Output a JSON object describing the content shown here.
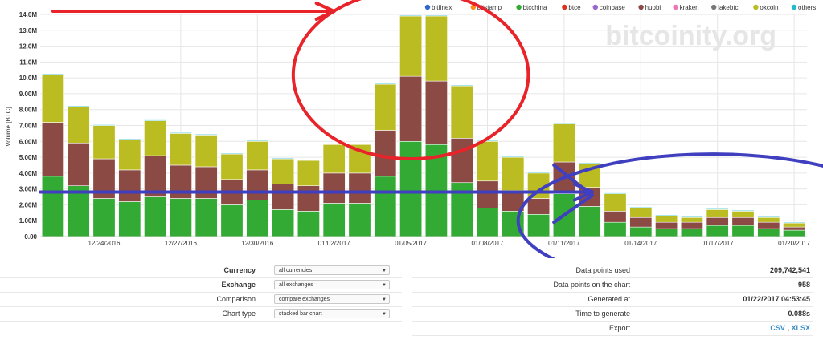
{
  "watermark": "bitcoinity.org",
  "chart_data": {
    "type": "bar",
    "stacked": true,
    "ylabel": "Volume [BTC]",
    "ylim": [
      0,
      14000000
    ],
    "yticks": [
      "0.00",
      "1.00M",
      "2.00M",
      "3.00M",
      "4.00M",
      "5.00M",
      "6.00M",
      "7.00M",
      "8.00M",
      "9.00M",
      "10.0M",
      "11.0M",
      "12.0M",
      "13.0M",
      "14.0M"
    ],
    "xtick_labels": [
      {
        "label": "12/24/2016",
        "index": 2.5
      },
      {
        "label": "12/27/2016",
        "index": 5.5
      },
      {
        "label": "12/30/2016",
        "index": 8.5
      },
      {
        "label": "01/02/2017",
        "index": 11.5
      },
      {
        "label": "01/05/2017",
        "index": 14.5
      },
      {
        "label": "01/08/2017",
        "index": 17.5
      },
      {
        "label": "01/11/2017",
        "index": 20.5
      },
      {
        "label": "01/14/2017",
        "index": 23.5
      },
      {
        "label": "01/17/2017",
        "index": 26.5
      },
      {
        "label": "01/20/2017",
        "index": 29.5
      }
    ],
    "legend": [
      "bitfinex",
      "bitstamp",
      "btcchina",
      "btce",
      "coinbase",
      "huobi",
      "kraken",
      "lakebtc",
      "okcoin",
      "others"
    ],
    "colors": {
      "bitfinex": "#3366cc",
      "bitstamp": "#ff8c1a",
      "btcchina": "#33aa33",
      "btce": "#dd3322",
      "coinbase": "#9966cc",
      "huobi": "#8b4a44",
      "kraken": "#ee77bb",
      "lakebtc": "#777777",
      "okcoin": "#bbbb22",
      "others": "#22bbcc"
    },
    "series": [
      {
        "name": "btcchina",
        "values": [
          3800000,
          3200000,
          2400000,
          2200000,
          2500000,
          2400000,
          2400000,
          2000000,
          2300000,
          1700000,
          1600000,
          2100000,
          2100000,
          3800000,
          6000000,
          5800000,
          3400000,
          1800000,
          1600000,
          1400000,
          2700000,
          1900000,
          900000,
          600000,
          500000,
          500000,
          700000,
          700000,
          500000,
          400000
        ]
      },
      {
        "name": "huobi",
        "values": [
          3400000,
          2700000,
          2500000,
          2000000,
          2600000,
          2100000,
          2000000,
          1600000,
          1900000,
          1600000,
          1600000,
          1900000,
          1900000,
          2900000,
          4100000,
          4000000,
          2800000,
          1700000,
          1300000,
          1000000,
          2000000,
          1200000,
          700000,
          600000,
          400000,
          400000,
          500000,
          500000,
          400000,
          200000
        ]
      },
      {
        "name": "okcoin",
        "values": [
          3000000,
          2300000,
          2100000,
          1900000,
          2200000,
          2000000,
          2000000,
          1600000,
          1800000,
          1600000,
          1600000,
          1800000,
          1800000,
          2900000,
          3800000,
          4100000,
          3300000,
          2500000,
          2100000,
          1600000,
          2400000,
          1500000,
          1100000,
          600000,
          400000,
          300000,
          500000,
          400000,
          300000,
          250000
        ]
      },
      {
        "name": "others",
        "values": [
          50000,
          50000,
          50000,
          50000,
          50000,
          50000,
          50000,
          50000,
          50000,
          50000,
          50000,
          50000,
          50000,
          50000,
          50000,
          50000,
          50000,
          50000,
          50000,
          50000,
          50000,
          50000,
          50000,
          50000,
          50000,
          50000,
          50000,
          50000,
          50000,
          50000
        ]
      }
    ],
    "grid": true,
    "legend_position": "top-right"
  },
  "annotations": [
    {
      "type": "arrow",
      "color": "#e8232a",
      "from_index": 0.5,
      "from_value": 14000000,
      "to_index": 11.5,
      "to_value": 14000000
    },
    {
      "type": "ellipse",
      "color": "#e8232a",
      "center_index": 14.5,
      "center_value": 10200000,
      "rx_bars": 4.6,
      "ry_value": 5300000
    },
    {
      "type": "arrow",
      "color": "#3f3fc0",
      "from_index": 0,
      "from_value": 2600000,
      "to_index": 21.6,
      "to_value": 2600000
    },
    {
      "type": "line",
      "color": "#3f3fc0",
      "from_index": 20.1,
      "from_value": 900000,
      "to_index": 21.6,
      "to_value": 2600000
    },
    {
      "type": "line",
      "color": "#3f3fc0",
      "from_index": 20.1,
      "from_value": 4500000,
      "to_index": 21.6,
      "to_value": 2600000
    },
    {
      "type": "ellipse",
      "color": "#3f3fc0",
      "center_index": 26.3,
      "center_value": 1000000,
      "rx_bars": 7.6,
      "ry_value": 4200000
    }
  ],
  "settings": [
    {
      "label": "Currency",
      "bold": true,
      "value": "all currencies"
    },
    {
      "label": "Exchange",
      "bold": true,
      "value": "all exchanges"
    },
    {
      "label": "Comparison",
      "bold": false,
      "value": "compare exchanges"
    },
    {
      "label": "Chart type",
      "bold": false,
      "value": "stacked bar chart"
    }
  ],
  "info": {
    "data_points_used": {
      "label": "Data points used",
      "value": "209,742,541"
    },
    "data_points_chart": {
      "label": "Data points on the chart",
      "value": "958"
    },
    "generated_at": {
      "label": "Generated at",
      "value": "01/22/2017 04:53:45"
    },
    "time_to_generate": {
      "label": "Time to generate",
      "value": "0.088s"
    },
    "export": {
      "label": "Export",
      "csv": "CSV",
      "separator": ",",
      "xlsx": "XLSX"
    }
  }
}
